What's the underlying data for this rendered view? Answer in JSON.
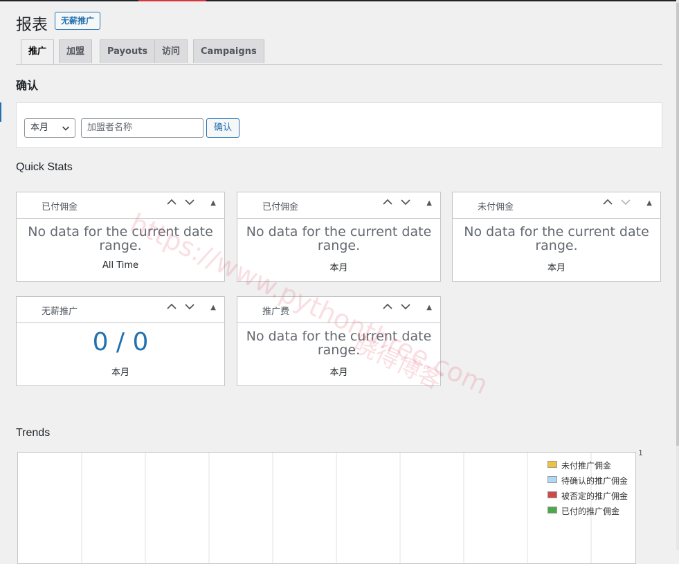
{
  "header": {
    "title": "报表",
    "badge": "无薪推广"
  },
  "tabs": [
    {
      "label": "推广",
      "active": true
    },
    {
      "label": "加盟",
      "active": false
    },
    {
      "label": "Payouts",
      "active": false
    },
    {
      "label": "访问",
      "active": false
    },
    {
      "label": "Campaigns",
      "active": false
    }
  ],
  "filter": {
    "section_title": "确认",
    "period_select": "本月",
    "affiliate_placeholder": "加盟者名称",
    "submit_label": "确认"
  },
  "quick_stats": {
    "title": "Quick Stats",
    "cards": [
      {
        "title": "已付佣金",
        "message": "No data for the current date range.",
        "period": "All Time"
      },
      {
        "title": "已付佣金",
        "message": "No data for the current date range.",
        "period": "本月"
      },
      {
        "title": "未付佣金",
        "message": "No data for the current date range.",
        "period": "本月"
      },
      {
        "title": "无薪推广",
        "value": "0 / 0",
        "period": "本月"
      },
      {
        "title": "推广费",
        "message": "No data for the current date range.",
        "period": "本月"
      }
    ]
  },
  "trends": {
    "title": "Trends",
    "y_tick": "1",
    "legend": [
      {
        "label": "未付推广佣金",
        "color": "#edc240"
      },
      {
        "label": "待确认的推广佣金",
        "color": "#afd8f8"
      },
      {
        "label": "被否定的推广佣金",
        "color": "#cb4b4b"
      },
      {
        "label": "已付的推广佣金",
        "color": "#4da74d"
      }
    ]
  },
  "watermark": {
    "line1": "https://www.pythonthree.com",
    "line2": "晓得博客"
  }
}
